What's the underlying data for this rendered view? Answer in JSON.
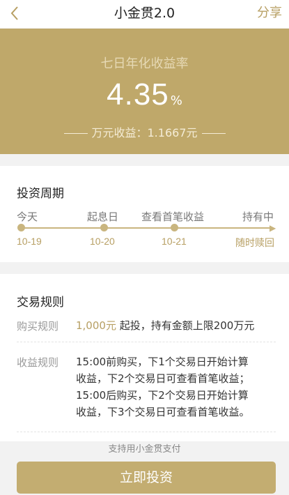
{
  "nav": {
    "back_icon": "chevron-left-icon",
    "title": "小金贯2.0",
    "share": "分享"
  },
  "hero": {
    "rate_label": "七日年化收益率",
    "rate_value": "4.35",
    "rate_unit": "%",
    "wan_text": "万元收益：1.1667元"
  },
  "period": {
    "title": "投资周期",
    "steps": [
      {
        "label": "今天",
        "date": "10-19"
      },
      {
        "label": "起息日",
        "date": "10-20"
      },
      {
        "label": "查看首笔收益",
        "date": "10-21"
      },
      {
        "label": "持有中",
        "date": "随时赎回"
      }
    ]
  },
  "rules": {
    "title": "交易规则",
    "buy_label": "购买规则",
    "buy_amount": "1,000元",
    "buy_text": " 起投，持有金额上限200万元",
    "profit_label": "收益规则",
    "profit_lines": [
      "15:00前购买，下1个交易日开始计算",
      "收益，下2个交易日可查看首笔收益；",
      "15:00后购买，下2个交易日开始计算",
      "收益，下3个交易日可查看首笔收益。"
    ]
  },
  "footer": {
    "support_text": "支持用小金贯支付",
    "invest_button": "立即投资"
  },
  "colors": {
    "gold": "#bfa86a",
    "gold_text": "#b79f63",
    "button": "#c3ad71"
  }
}
